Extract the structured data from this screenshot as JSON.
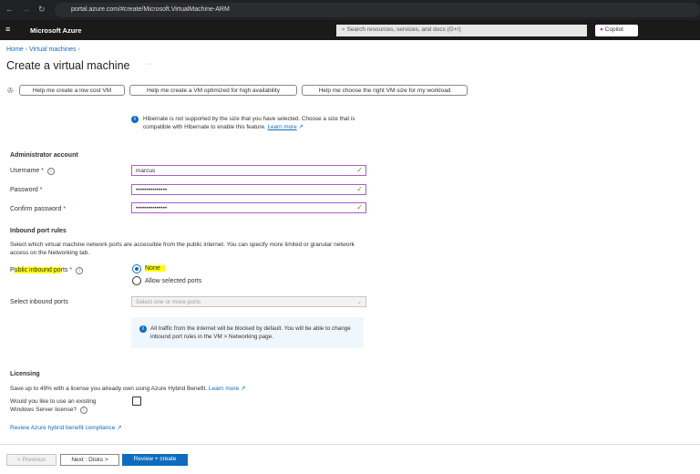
{
  "browser": {
    "url": "portal.azure.com/#create/Microsoft.VirtualMachine-ARM"
  },
  "header": {
    "brand": "Microsoft Azure",
    "search_placeholder": "Search resources, services, and docs (G+/)",
    "copilot": "Copilot"
  },
  "breadcrumb": [
    "Home",
    "Virtual machines"
  ],
  "page": {
    "title": "Create a virtual machine",
    "more": "···"
  },
  "help_buttons": [
    "Help me create a low cost VM",
    "Help me create a VM optimized for high availability",
    "Help me choose the right VM size for my workload"
  ],
  "hibernate_info": {
    "text": "Hibernate is not supported by the size that you have selected. Choose a size that is compatible with Hibernate to enable this feature.",
    "link": "Learn more"
  },
  "admin": {
    "heading": "Administrator account",
    "username_label": "Username",
    "username_value": "marcus",
    "password_label": "Password",
    "password_value": "•••••••••••••••",
    "confirm_label": "Confirm password",
    "confirm_value": "•••••••••••••••"
  },
  "inbound": {
    "heading": "Inbound port rules",
    "description": "Select which virtual machine network ports are accessible from the public internet. You can specify more limited or granular network access on the Networking tab.",
    "public_label_pre": "P",
    "public_label_hl": "ublic inbound po",
    "public_label_post": "rts",
    "options": [
      "None",
      "Allow selected ports"
    ],
    "selected": "None",
    "select_label": "Select inbound ports",
    "select_placeholder": "Select one or more ports",
    "info": "All traffic from the internet will be blocked by default. You will be able to change inbound port rules in the VM > Networking page."
  },
  "licensing": {
    "heading": "Licensing",
    "description": "Save up to 49% with a license you already own using Azure Hybrid Benefit.",
    "learn_more": "Learn more",
    "question": "Would you like to use an existing Windows Server license?",
    "checked": false,
    "compliance_link": "Review Azure hybrid benefit compliance"
  },
  "footer": {
    "previous": "< Previous",
    "next": "Next : Disks >",
    "review": "Review + create"
  },
  "colors": {
    "accent": "#0f6cbd",
    "field_border": "#a65fc8",
    "highlight": "#ffff00"
  }
}
